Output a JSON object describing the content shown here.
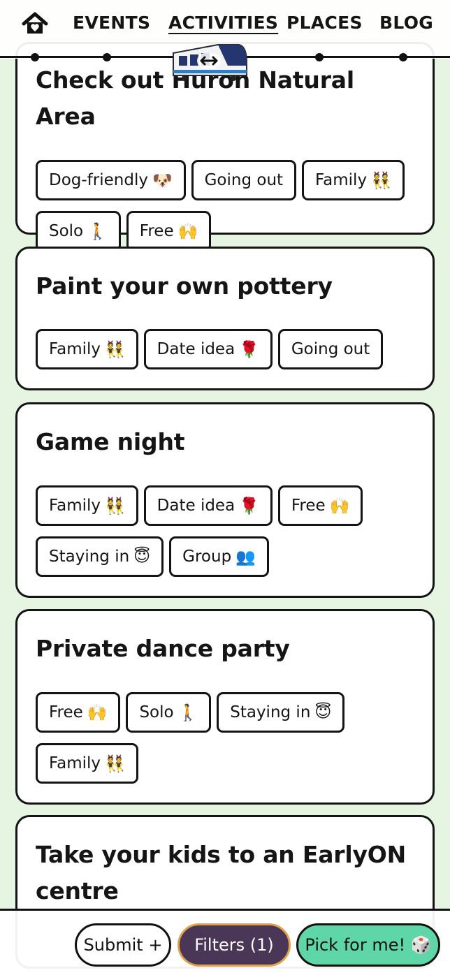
{
  "nav": {
    "links": [
      "EVENTS",
      "ACTIVITIES",
      "PLACES",
      "BLOG"
    ],
    "active": "ACTIVITIES"
  },
  "cards": [
    {
      "title": "Check out Huron Natural Area",
      "tags": [
        {
          "label": "Dog-friendly",
          "emoji": "🐶"
        },
        {
          "label": "Going out",
          "emoji": ""
        },
        {
          "label": "Family",
          "emoji": "👯"
        },
        {
          "label": "Solo",
          "emoji": "🚶"
        },
        {
          "label": "Free",
          "emoji": "🙌"
        }
      ]
    },
    {
      "title": "Paint your own pottery",
      "tags": [
        {
          "label": "Family",
          "emoji": "👯"
        },
        {
          "label": "Date idea",
          "emoji": "🌹"
        },
        {
          "label": "Going out",
          "emoji": ""
        }
      ]
    },
    {
      "title": "Game night",
      "tags": [
        {
          "label": "Family",
          "emoji": "👯"
        },
        {
          "label": "Date idea",
          "emoji": "🌹"
        },
        {
          "label": "Free",
          "emoji": "🙌"
        },
        {
          "label": "Staying in",
          "emoji": "😇"
        },
        {
          "label": "Group",
          "emoji": "👥"
        }
      ]
    },
    {
      "title": "Private dance party",
      "tags": [
        {
          "label": "Free",
          "emoji": "🙌"
        },
        {
          "label": "Solo",
          "emoji": "🚶"
        },
        {
          "label": "Staying in",
          "emoji": "😇"
        },
        {
          "label": "Family",
          "emoji": "👯"
        }
      ]
    },
    {
      "title": "Take your kids to an EarlyON centre",
      "tags": []
    }
  ],
  "bottom": {
    "submit_label": "Submit +",
    "filters_label": "Filters (1)",
    "pick_label": "Pick for me! 🎲"
  },
  "colors": {
    "background": "#e6f4e2",
    "filters_bg": "#4a3656",
    "filters_border": "#e0a24a",
    "pick_bg": "#5fd6a8"
  },
  "icons": {
    "home": "house-heart-icon",
    "train": "lrt-train-icon"
  }
}
